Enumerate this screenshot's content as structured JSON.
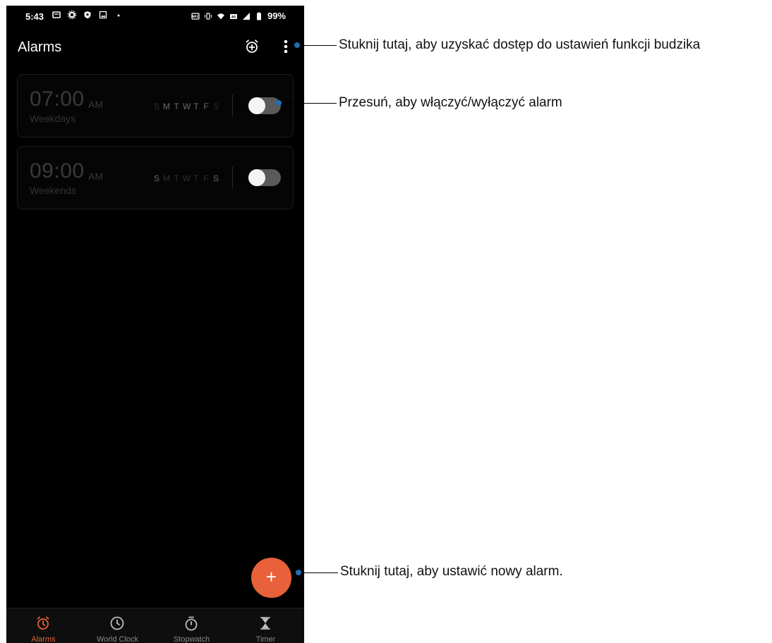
{
  "status_bar": {
    "time": "5:43",
    "battery": "99%",
    "left_icons": [
      "notification-icon",
      "settings-icon",
      "shield-icon",
      "image-icon"
    ],
    "right_icons": [
      "nfc-icon",
      "vibrate-icon",
      "wifi-icon",
      "volte-icon",
      "signal-icon",
      "battery-icon"
    ]
  },
  "app_bar": {
    "title": "Alarms",
    "icons": [
      "bedtime-alarm-icon",
      "more-vert-icon"
    ]
  },
  "alarms": [
    {
      "time": "07:00",
      "ampm": "AM",
      "label": "Weekdays",
      "days": [
        "S",
        "M",
        "T",
        "W",
        "T",
        "F",
        "S"
      ],
      "active_days": [
        false,
        true,
        true,
        true,
        true,
        true,
        false
      ],
      "enabled": false
    },
    {
      "time": "09:00",
      "ampm": "AM",
      "label": "Weekends",
      "days": [
        "S",
        "M",
        "T",
        "W",
        "T",
        "F",
        "S"
      ],
      "active_days": [
        true,
        false,
        false,
        false,
        false,
        false,
        true
      ],
      "enabled": false
    }
  ],
  "fab": {
    "symbol": "+"
  },
  "bottom_nav": {
    "items": [
      {
        "label": "Alarms",
        "icon": "alarm-icon",
        "active": true
      },
      {
        "label": "World Clock",
        "icon": "clock-icon",
        "active": false
      },
      {
        "label": "Stopwatch",
        "icon": "stopwatch-icon",
        "active": false
      },
      {
        "label": "Timer",
        "icon": "hourglass-icon",
        "active": false
      }
    ]
  },
  "callouts": {
    "settings": "Stuknij tutaj, aby uzyskać dostęp do ustawień funkcji budzika",
    "toggle": "Przesuń, aby włączyć/wyłączyć alarm",
    "add": "Stuknij tutaj, aby ustawić nowy alarm."
  },
  "colors": {
    "accent": "#e8613a",
    "callout_dot": "#1f6fb2",
    "background": "#000000"
  }
}
